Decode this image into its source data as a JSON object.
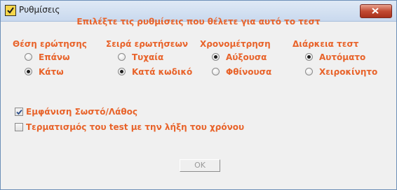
{
  "window": {
    "title": "Ρυθμίσεις"
  },
  "heading": "Επιλέξτε τις ρυθμίσεις που θέλετε για αυτό το τεστ",
  "groups": [
    {
      "title": "Θέση ερώτησης",
      "options": [
        {
          "label": "Επάνω",
          "selected": false
        },
        {
          "label": "Κάτω",
          "selected": true
        }
      ]
    },
    {
      "title": "Σειρά ερωτήσεων",
      "options": [
        {
          "label": "Τυχαία",
          "selected": false
        },
        {
          "label": "Κατά κωδικό",
          "selected": true
        }
      ]
    },
    {
      "title": "Χρονομέτρηση",
      "options": [
        {
          "label": "Αύξουσα",
          "selected": true
        },
        {
          "label": "Φθίνουσα",
          "selected": false
        }
      ]
    },
    {
      "title": "Διάρκεια τεστ",
      "options": [
        {
          "label": "Αυτόματο",
          "selected": true
        },
        {
          "label": "Χειροκίνητο",
          "selected": false
        }
      ]
    }
  ],
  "checkboxes": [
    {
      "label": "Εμφάνιση Σωστό/Λάθος",
      "checked": true
    },
    {
      "label": "Τερματισμός του test με την λήξη του χρόνου",
      "checked": false
    }
  ],
  "ok_button": {
    "label": "OK"
  },
  "colors": {
    "accent": "#e8632a",
    "frame": "#6d8fb8",
    "background": "#f0f0f0"
  },
  "icons": {
    "app": "checkmark-app-icon",
    "close": "close-icon"
  }
}
